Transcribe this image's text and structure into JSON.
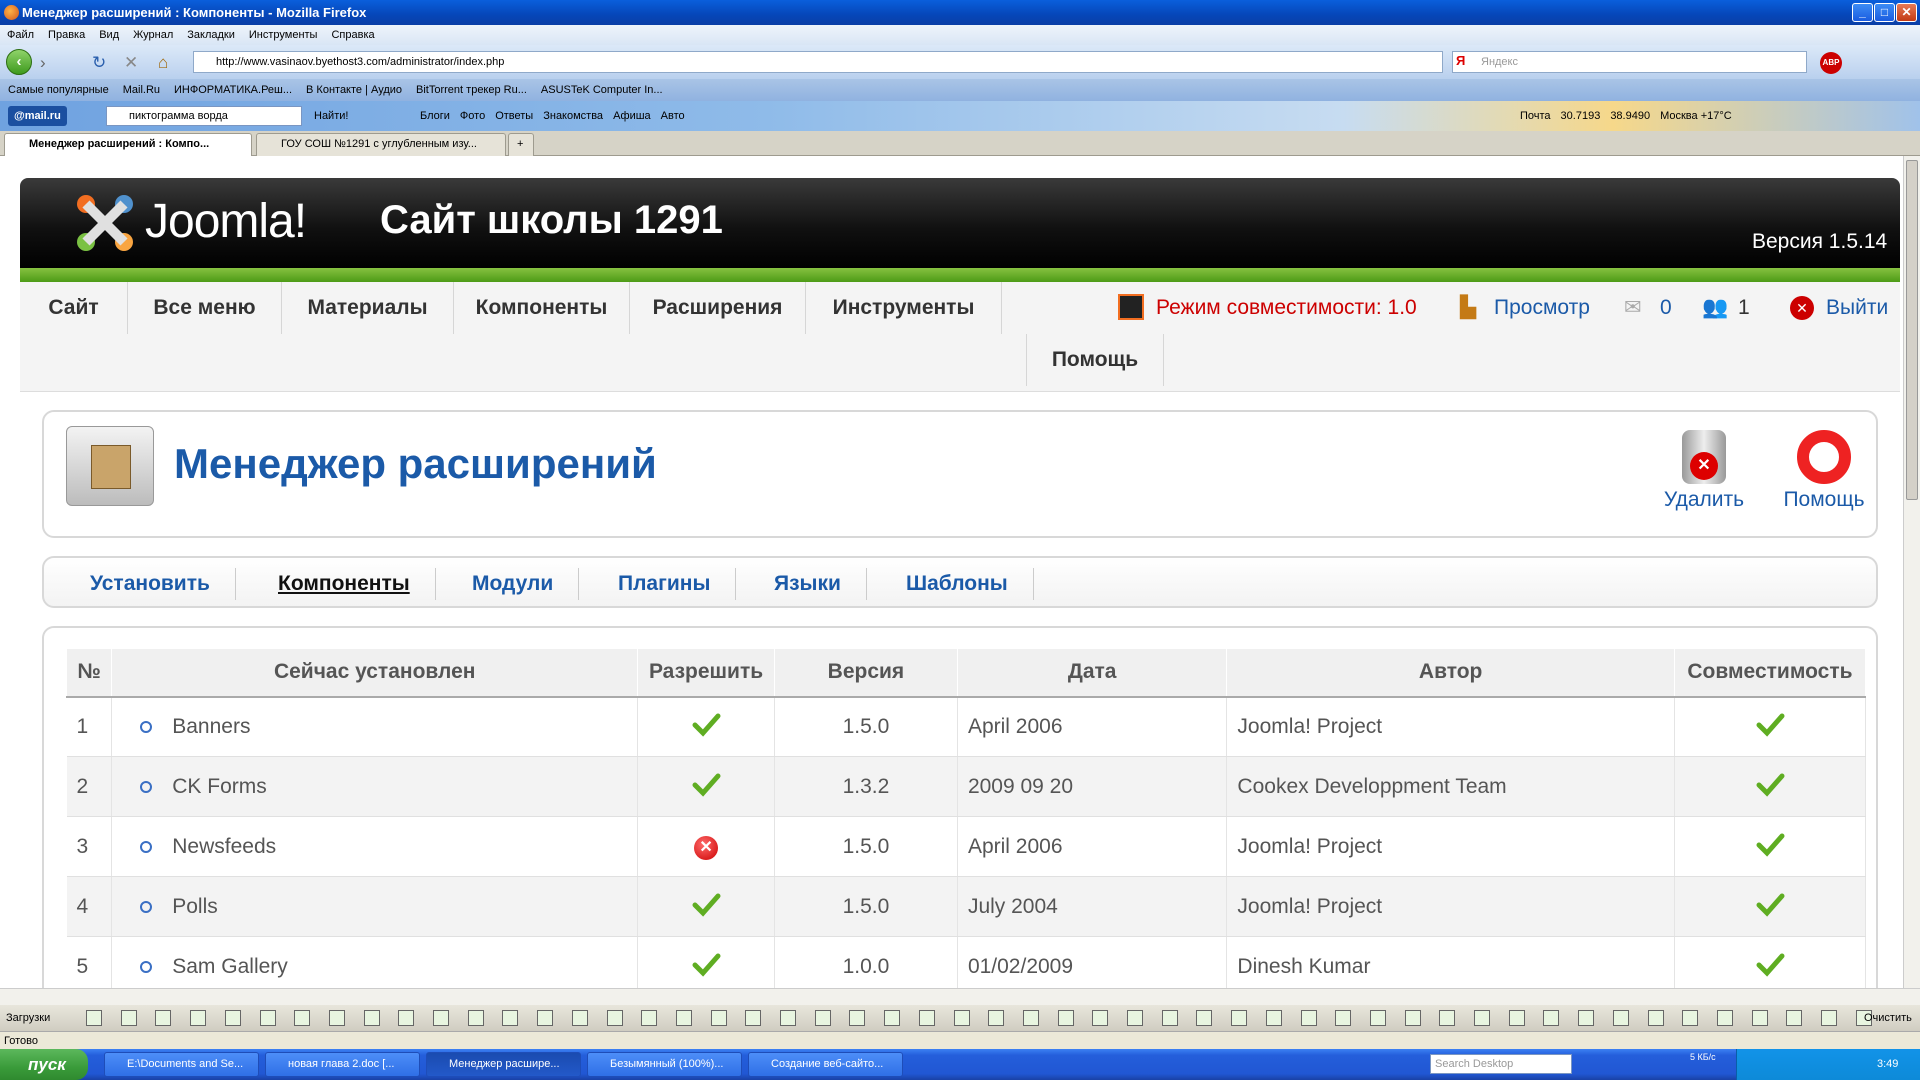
{
  "browser": {
    "title": "Менеджер расширений : Компоненты - Mozilla Firefox",
    "menu": [
      "Файл",
      "Правка",
      "Вид",
      "Журнал",
      "Закладки",
      "Инструменты",
      "Справка"
    ],
    "url": "http://www.vasinaov.byethost3.com/administrator/index.php",
    "search_placeholder": "Яндекс",
    "search_engine_label": "Я",
    "bookmarks": [
      "Самые популярные",
      "Mail.Ru",
      "ИНФОРМАТИКА.Реш...",
      "В Контакте | Аудио",
      "BitTorrent трекер Ru...",
      "ASUSTeK Computer In..."
    ],
    "mailru_label": "@mail.ru",
    "mailru_search_value": "пиктограмма ворда",
    "mailru_find": "Найти!",
    "mailru_links": [
      "Блоги",
      "Фото",
      "Ответы",
      "Знакомства",
      "Афиша",
      "Авто"
    ],
    "mailru_right": [
      "Почта",
      "30.7193",
      "38.9490",
      "Москва +17°С"
    ],
    "tabs": [
      {
        "label": "Менеджер расширений : Компо...",
        "active": true
      },
      {
        "label": "ГОУ СОШ №1291 с углубленным изу...",
        "active": false
      }
    ],
    "status_text": "Готово"
  },
  "joomla": {
    "logo_text": "Joomla!",
    "site_name": "Сайт школы 1291",
    "version": "Версия 1.5.14",
    "menu": [
      "Сайт",
      "Все меню",
      "Материалы",
      "Компоненты",
      "Расширения",
      "Инструменты",
      "Помощь"
    ],
    "status": {
      "compat": "Режим совместимости: 1.0",
      "preview": "Просмотр",
      "messages": "0",
      "users": "1",
      "logout": "Выйти"
    },
    "toolbar": {
      "title": "Менеджер расширений",
      "delete": "Удалить",
      "help": "Помощь"
    },
    "submenu": [
      "Установить",
      "Компоненты",
      "Модули",
      "Плагины",
      "Языки",
      "Шаблоны"
    ],
    "submenu_active": "Компоненты",
    "table": {
      "headers": [
        "№",
        "Сейчас установлен",
        "Разрешить",
        "Версия",
        "Дата",
        "Автор",
        "Совместимость"
      ],
      "rows": [
        {
          "num": "1",
          "name": "Banners",
          "enabled": true,
          "version": "1.5.0",
          "date": "April 2006",
          "author": "Joomla! Project",
          "compat": true
        },
        {
          "num": "2",
          "name": "CK Forms",
          "enabled": true,
          "version": "1.3.2",
          "date": "2009 09 20",
          "author": "Cookex Developpment Team",
          "compat": true
        },
        {
          "num": "3",
          "name": "Newsfeeds",
          "enabled": false,
          "version": "1.5.0",
          "date": "April 2006",
          "author": "Joomla! Project",
          "compat": true
        },
        {
          "num": "4",
          "name": "Polls",
          "enabled": true,
          "version": "1.5.0",
          "date": "July 2004",
          "author": "Joomla! Project",
          "compat": true
        },
        {
          "num": "5",
          "name": "Sam Gallery",
          "enabled": true,
          "version": "1.0.0",
          "date": "01/02/2009",
          "author": "Dinesh Kumar",
          "compat": true
        }
      ]
    },
    "colors": {
      "accent": "#1b5aa8",
      "green": "#5fad22",
      "red": "#cc0000"
    }
  },
  "downloads": {
    "label": "Загрузки",
    "clear": "Очистить"
  },
  "taskbar": {
    "start": "пуск",
    "items": [
      "E:\\Documents and Se...",
      "новая глава 2.doc [...",
      "Менеджер расшире...",
      "Безымянный (100%)...",
      "Создание веб-сайто..."
    ],
    "active_index": 2,
    "search_placeholder": "Search Desktop",
    "net_speed": "5 КБ/с",
    "clock": "3:49"
  }
}
